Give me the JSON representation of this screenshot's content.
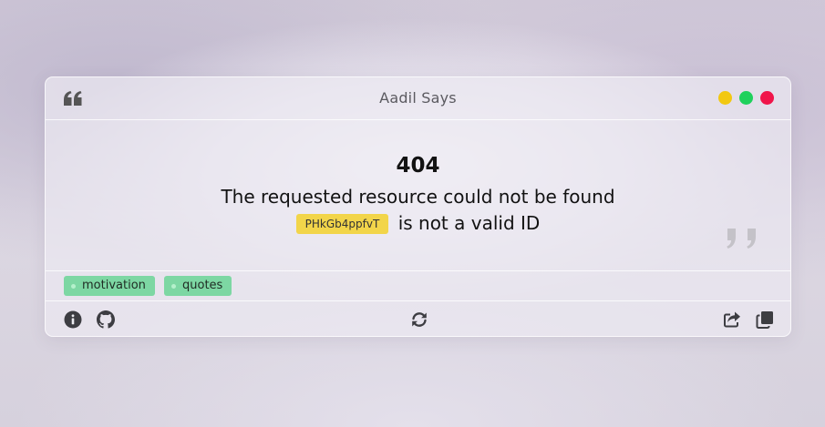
{
  "window": {
    "title": "Aadil Says",
    "controls": {
      "colors": [
        "#f2c811",
        "#1fd15c",
        "#f0154a"
      ]
    },
    "open_quote_icon": "quote-open-icon",
    "close_quote_icon": "quote-close-icon"
  },
  "error": {
    "code": "404",
    "message": "The requested resource could not be found",
    "id": "PHkGb4ppfvT",
    "id_suffix": "is not a valid ID"
  },
  "tags": [
    "motivation",
    "quotes"
  ],
  "footer": {
    "left_icons": [
      "info-icon",
      "github-icon"
    ],
    "center_icon": "refresh-icon",
    "right_icons": [
      "share-icon",
      "copy-icon"
    ]
  },
  "colors": {
    "tag_bg": "#7dd7a3",
    "id_badge_bg": "#f2d54a",
    "icon": "#3d3d42"
  }
}
